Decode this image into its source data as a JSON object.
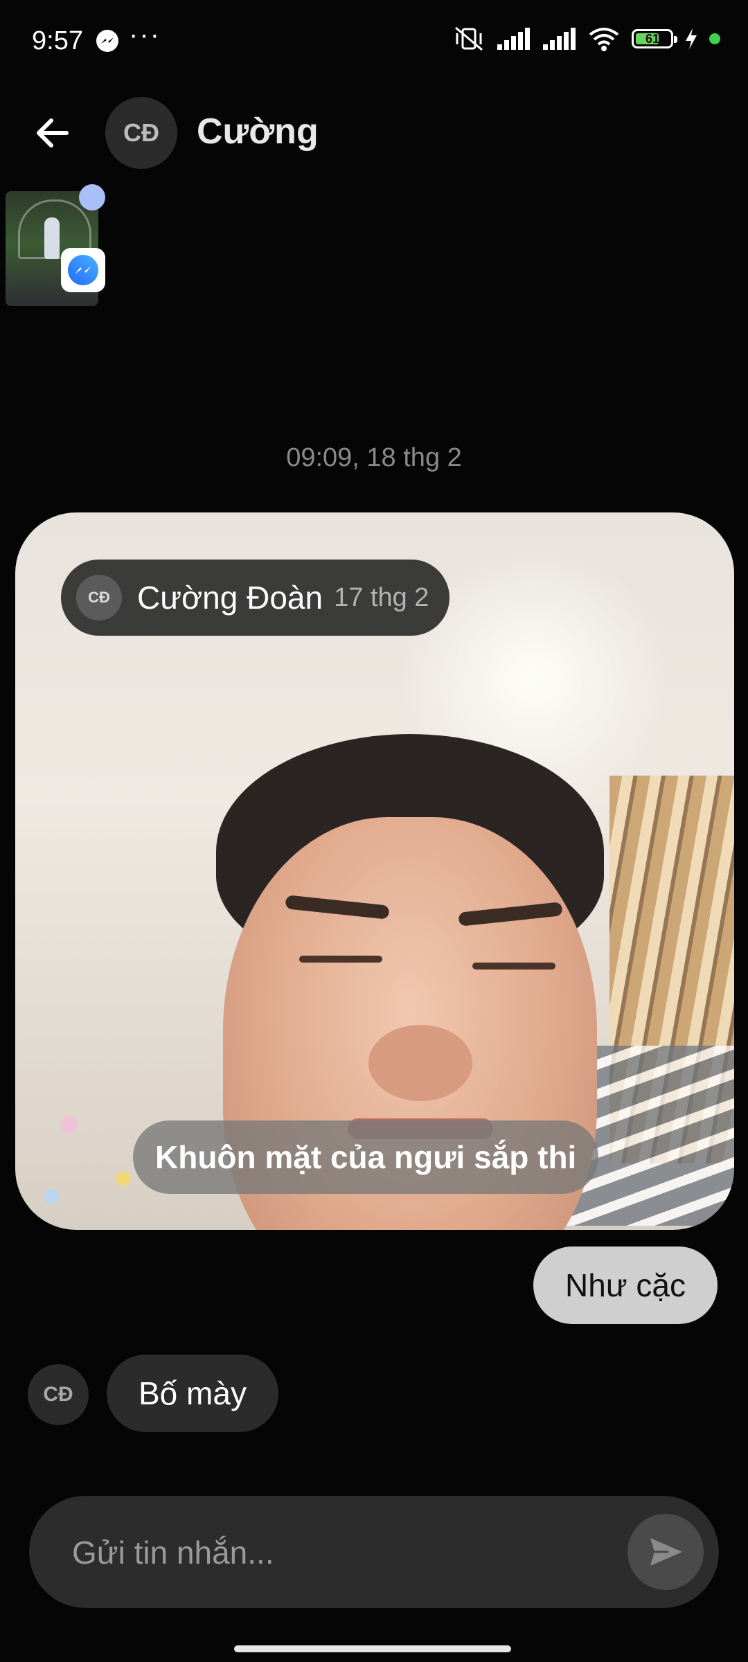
{
  "status_bar": {
    "time": "9:57",
    "battery_level": "61",
    "icons": [
      "messenger-icon",
      "more-dots-icon",
      "vibrate-off-icon",
      "signal-icon",
      "signal-icon",
      "wifi-icon",
      "battery-icon",
      "charging-icon",
      "status-dot-icon"
    ],
    "colors": {
      "battery_fill": "#6ad35c",
      "status_dot": "#3cd44f"
    }
  },
  "header": {
    "back_icon": "arrow-left-icon",
    "avatar_initials": "CĐ",
    "contact_name": "Cường"
  },
  "floating": {
    "badge_icon": "messenger-icon"
  },
  "conversation": {
    "timestamp": "09:09, 18 thg 2",
    "photo_message": {
      "sender_initials": "CĐ",
      "sender_name": "Cường Đoàn",
      "sender_date": "17 thg 2",
      "caption": "Khuôn mặt của ngưi sắp thi"
    },
    "outgoing_message": "Như cặc",
    "incoming_message": {
      "avatar_initials": "CĐ",
      "text": "Bố mày"
    }
  },
  "composer": {
    "placeholder": "Gửi tin nhắn...",
    "send_icon": "send-icon"
  }
}
